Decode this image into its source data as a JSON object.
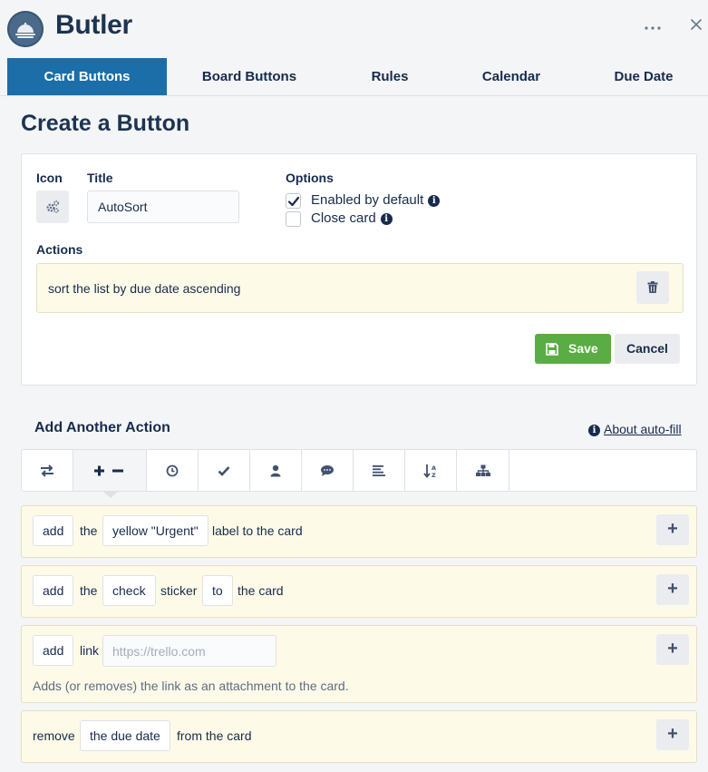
{
  "header": {
    "title": "Butler",
    "more_icon": "ellipsis-icon",
    "close_icon": "close-icon",
    "logo_icon": "butler-bell-icon"
  },
  "tabs": [
    {
      "label": "Card Buttons",
      "active": true
    },
    {
      "label": "Board Buttons",
      "active": false
    },
    {
      "label": "Rules",
      "active": false
    },
    {
      "label": "Calendar",
      "active": false
    },
    {
      "label": "Due Date",
      "active": false
    }
  ],
  "page_title": "Create a Button",
  "form": {
    "icon_label": "Icon",
    "icon_name": "gears-icon",
    "title_label": "Title",
    "title_value": "AutoSort",
    "options_label": "Options",
    "options": [
      {
        "label": "Enabled by default",
        "checked": true
      },
      {
        "label": "Close card",
        "checked": false
      }
    ],
    "actions_label": "Actions",
    "actions": [
      "sort the list by due date ascending"
    ],
    "save_label": "Save",
    "cancel_label": "Cancel"
  },
  "add_action": {
    "title": "Add Another Action",
    "autofill_link": "About auto-fill",
    "tools": [
      {
        "icon": "move-arrows-icon",
        "active": false
      },
      {
        "icon": "add-remove-icon",
        "active": true
      },
      {
        "icon": "clock-icon",
        "active": false
      },
      {
        "icon": "checkmark-icon",
        "active": false
      },
      {
        "icon": "user-icon",
        "active": false
      },
      {
        "icon": "comment-icon",
        "active": false
      },
      {
        "icon": "align-left-icon",
        "active": false
      },
      {
        "icon": "sort-az-icon",
        "active": false
      },
      {
        "icon": "hierarchy-icon",
        "active": false
      }
    ],
    "cards": [
      {
        "verb": "add",
        "w1": "the",
        "chip": "yellow \"Urgent\"",
        "w2": "label to the card"
      },
      {
        "verb": "add",
        "w1": "the",
        "chip": "check",
        "w2": "sticker",
        "chip2": "to",
        "w3": "the card"
      },
      {
        "verb": "add",
        "w1": "link",
        "placeholder": "https://trello.com",
        "hint": "Adds (or removes) the link as an attachment to the card."
      },
      {
        "w0": "remove",
        "chip": "the due date",
        "w2": "from the card"
      }
    ]
  },
  "colors": {
    "accent": "#1b6ea8",
    "save": "#5aac44",
    "action_bg": "#fdfbe8"
  }
}
